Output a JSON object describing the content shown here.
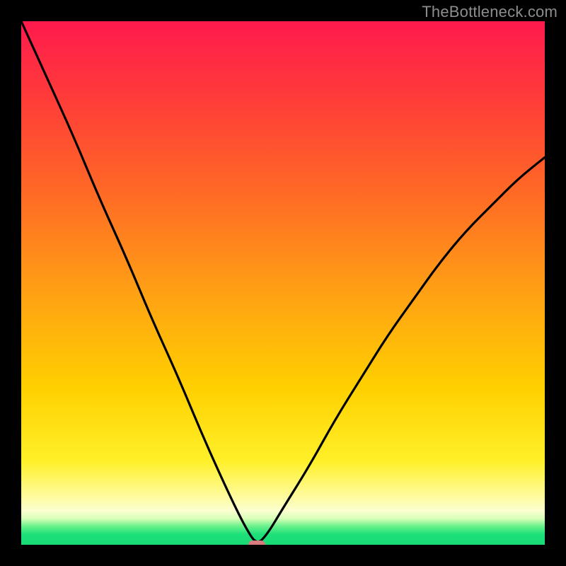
{
  "watermark": {
    "text": "TheBottleneck.com"
  },
  "colors": {
    "frame": "#000000",
    "curve": "#000000",
    "marker": "#d77b7f",
    "gradient_top": "#ff1a4d",
    "gradient_mid": "#ffd000",
    "gradient_bottom": "#19db76"
  },
  "chart_data": {
    "type": "line",
    "title": "",
    "xlabel": "",
    "ylabel": "",
    "xlim": [
      0,
      100
    ],
    "ylim": [
      0,
      100
    ],
    "grid": false,
    "legend": false,
    "background_color_scale": {
      "description": "vertical gradient mapping bottleneck severity, green (low) at bottom to red (high) at top",
      "stops": [
        {
          "pos": 0.0,
          "color": "#ff1a4d"
        },
        {
          "pos": 0.14,
          "color": "#ff3a3a"
        },
        {
          "pos": 0.33,
          "color": "#ff6a25"
        },
        {
          "pos": 0.52,
          "color": "#ffa114"
        },
        {
          "pos": 0.7,
          "color": "#ffd000"
        },
        {
          "pos": 0.84,
          "color": "#fff029"
        },
        {
          "pos": 0.9,
          "color": "#fffa90"
        },
        {
          "pos": 0.935,
          "color": "#fbffd0"
        },
        {
          "pos": 0.95,
          "color": "#d7ffb8"
        },
        {
          "pos": 0.965,
          "color": "#66f08a"
        },
        {
          "pos": 0.98,
          "color": "#1de07a"
        },
        {
          "pos": 1.0,
          "color": "#19db76"
        }
      ]
    },
    "series": [
      {
        "name": "bottleneck-curve",
        "note": "V-shaped curve; left branch steeper, right branch shallower; minimum at x≈45 y≈0",
        "x": [
          0,
          5,
          10,
          15,
          20,
          25,
          30,
          35,
          40,
          43,
          45,
          47,
          50,
          55,
          60,
          65,
          70,
          75,
          80,
          85,
          90,
          95,
          100
        ],
        "y": [
          100,
          89,
          78,
          66,
          55,
          43,
          32,
          20,
          9,
          3,
          0,
          2,
          7,
          15,
          24,
          32,
          40,
          47,
          54,
          60,
          65,
          70,
          74
        ]
      }
    ],
    "minimum_marker": {
      "x": 45,
      "y": 0,
      "color": "#d77b7f",
      "shape": "rounded-rect"
    }
  }
}
